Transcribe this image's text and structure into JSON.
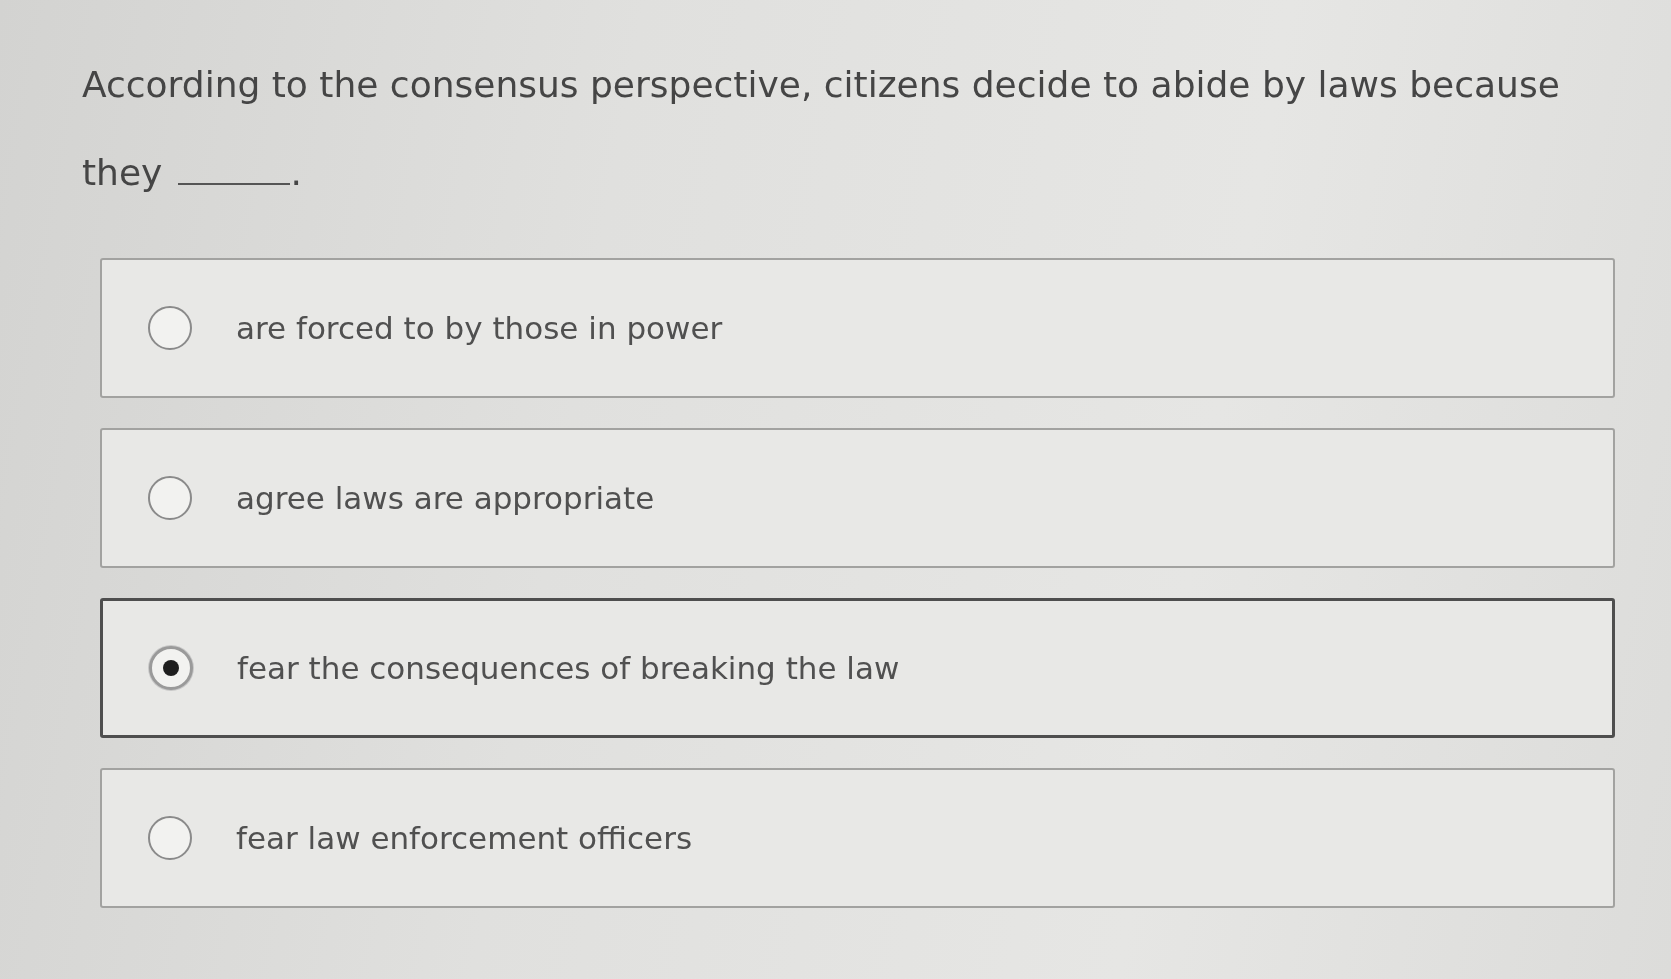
{
  "question": {
    "text": "According to the consensus perspective, citizens decide to abide by laws because they",
    "after_blank": "."
  },
  "options": [
    {
      "label": "are forced to by those in power",
      "selected": false
    },
    {
      "label": "agree laws are appropriate",
      "selected": false
    },
    {
      "label": "fear the consequences of breaking the law",
      "selected": true
    },
    {
      "label": "fear law enforcement officers",
      "selected": false
    }
  ]
}
